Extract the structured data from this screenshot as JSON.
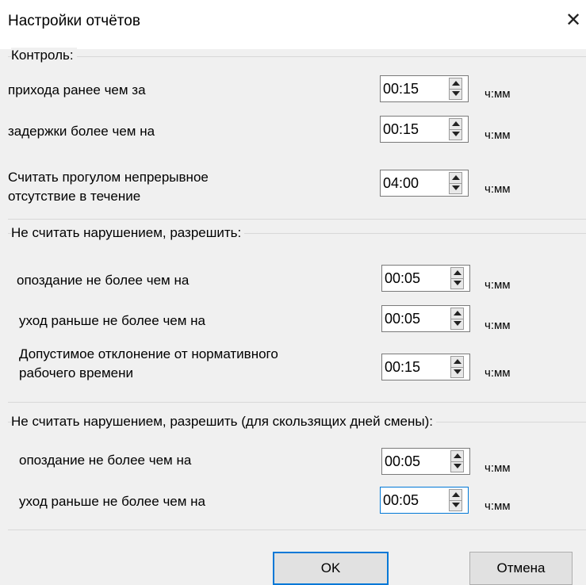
{
  "window": {
    "title": "Настройки отчётов",
    "close_icon": "close-icon"
  },
  "control": {
    "title": "Контроль:",
    "rows": [
      {
        "label": "прихода ранее чем за",
        "value": "00:15",
        "unit": "ч:мм"
      },
      {
        "label": "задержки более чем на",
        "value": "00:15",
        "unit": "ч:мм"
      },
      {
        "label_line1": "Считать прогулом непрерывное",
        "label_line2": "отсутствие в течение",
        "value": "04:00",
        "unit": "ч:мм"
      }
    ]
  },
  "allow": {
    "title": "Не считать нарушением, разрешить:",
    "rows": [
      {
        "label": "опоздание не более чем на",
        "value": "00:05",
        "unit": "ч:мм"
      },
      {
        "label": "уход раньше не более чем на",
        "value": "00:05",
        "unit": "ч:мм"
      },
      {
        "label_line1": "Допустимое отклонение от нормативного",
        "label_line2": "рабочего времени",
        "value": "00:15",
        "unit": "ч:мм"
      }
    ]
  },
  "allow_sliding": {
    "title": "Не считать нарушением, разрешить (для скользящих дней смены):",
    "rows": [
      {
        "label": "опоздание не более чем на",
        "value": "00:05",
        "unit": "ч:мм"
      },
      {
        "label": "уход раньше не более чем на",
        "value": "00:05",
        "unit": "ч:мм"
      }
    ]
  },
  "buttons": {
    "ok": "OK",
    "cancel": "Отмена"
  }
}
